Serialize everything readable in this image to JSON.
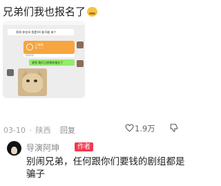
{
  "post": {
    "title": "兄弟们我也报名了",
    "emoji_icon": "crying-face-emoji",
    "screenshot": {
      "line1": "哥哥 你在吗 我是XX 能不能 来个",
      "transfer_label": "已收款",
      "transfer_sub": "¥ ——",
      "transfer_footer": "微信转账",
      "reply_bubble": "收到 我们已经帮你报名了",
      "sticker": "cat-meme-sticker"
    },
    "date": "03-10",
    "separator": "·",
    "location": "陕西",
    "reply_label": "回复",
    "like_icon": "heart-outline-icon",
    "like_count": "1.9万",
    "dislike_icon": "thumbs-down-icon"
  },
  "reply": {
    "avatar": "user-avatar",
    "username": "导演阿坤",
    "badge": "作者",
    "text": "别闹兄弟，任何跟你们要钱的剧组都是骗子"
  }
}
